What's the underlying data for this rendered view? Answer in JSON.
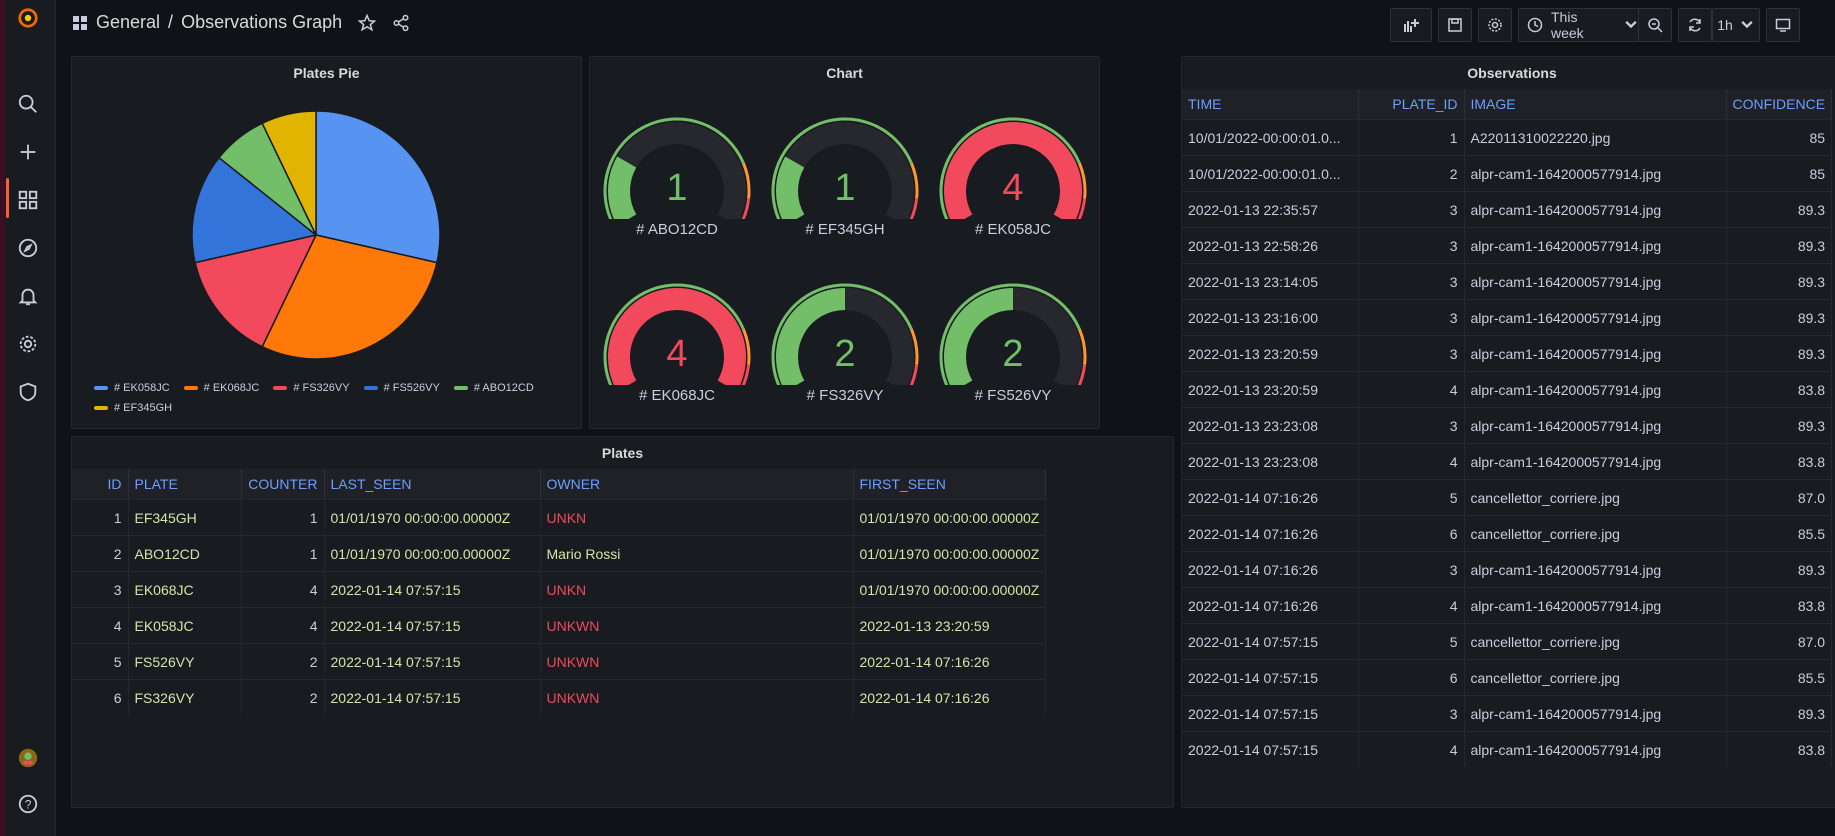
{
  "breadcrumb": {
    "folder": "General",
    "separator": "/",
    "title": "Observations Graph"
  },
  "toolbar": {
    "time_range": "This week",
    "refresh_interval": "1h"
  },
  "colors": {
    "green": "#73bf69",
    "red": "#f2495c",
    "blue": "#5794f2",
    "orange": "#ff780a",
    "yellow": "#f2cc0c"
  },
  "pie_panel": {
    "title": "Plates Pie",
    "chart_data": {
      "type": "pie",
      "slices": [
        {
          "label": "# EK058JC",
          "value": 4,
          "color": "#5794f2"
        },
        {
          "label": "# EK068JC",
          "value": 4,
          "color": "#ff780a"
        },
        {
          "label": "# FS326VY",
          "value": 2,
          "color": "#f2495c"
        },
        {
          "label": "# FS526VY",
          "value": 2,
          "color": "#3274d9"
        },
        {
          "label": "# ABO12CD",
          "value": 1,
          "color": "#73bf69"
        },
        {
          "label": "# EF345GH",
          "value": 1,
          "color": "#e0b400"
        }
      ],
      "legend_placement": "bottom"
    }
  },
  "chart_panel": {
    "title": "Chart",
    "gauges": [
      {
        "label": "# ABO12CD",
        "value": "1",
        "fraction": 0.25,
        "color": "#73bf69"
      },
      {
        "label": "# EF345GH",
        "value": "1",
        "fraction": 0.25,
        "color": "#73bf69"
      },
      {
        "label": "# EK058JC",
        "value": "4",
        "fraction": 1.0,
        "color": "#f2495c"
      },
      {
        "label": "# EK068JC",
        "value": "4",
        "fraction": 1.0,
        "color": "#f2495c"
      },
      {
        "label": "# FS326VY",
        "value": "2",
        "fraction": 0.5,
        "color": "#73bf69"
      },
      {
        "label": "# FS526VY",
        "value": "2",
        "fraction": 0.5,
        "color": "#73bf69"
      }
    ]
  },
  "plates_panel": {
    "title": "Plates",
    "columns": [
      "ID",
      "PLATE",
      "COUNTER",
      "LAST_SEEN",
      "OWNER",
      "FIRST_SEEN"
    ],
    "rows": [
      {
        "id": "1",
        "plate": "EF345GH",
        "counter": "1",
        "last_seen": "01/01/1970 00:00:00.00000Z",
        "owner": "UNKN",
        "first_seen": "01/01/1970 00:00:00.00000Z"
      },
      {
        "id": "2",
        "plate": "ABO12CD",
        "counter": "1",
        "last_seen": "01/01/1970 00:00:00.00000Z",
        "owner": "Mario Rossi",
        "first_seen": "01/01/1970 00:00:00.00000Z"
      },
      {
        "id": "3",
        "plate": "EK068JC",
        "counter": "4",
        "last_seen": "2022-01-14 07:57:15",
        "owner": "UNKN",
        "first_seen": "01/01/1970 00:00:00.00000Z"
      },
      {
        "id": "4",
        "plate": "EK058JC",
        "counter": "4",
        "last_seen": "2022-01-14 07:57:15",
        "owner": "UNKWN",
        "first_seen": "2022-01-13 23:20:59"
      },
      {
        "id": "5",
        "plate": "FS526VY",
        "counter": "2",
        "last_seen": "2022-01-14 07:57:15",
        "owner": "UNKWN",
        "first_seen": "2022-01-14 07:16:26"
      },
      {
        "id": "6",
        "plate": "FS326VY",
        "counter": "2",
        "last_seen": "2022-01-14 07:57:15",
        "owner": "UNKWN",
        "first_seen": "2022-01-14 07:16:26"
      }
    ]
  },
  "observations_panel": {
    "title": "Observations",
    "columns": [
      "TIME",
      "PLATE_ID",
      "IMAGE",
      "CONFIDENCE"
    ],
    "rows": [
      {
        "time": "10/01/2022-00:00:01.0...",
        "plate_id": "1",
        "image": "A22011310022220.jpg",
        "confidence": "85"
      },
      {
        "time": "10/01/2022-00:00:01.0...",
        "plate_id": "2",
        "image": "alpr-cam1-1642000577914.jpg",
        "confidence": "85"
      },
      {
        "time": "2022-01-13 22:35:57",
        "plate_id": "3",
        "image": "alpr-cam1-1642000577914.jpg",
        "confidence": "89.3"
      },
      {
        "time": "2022-01-13 22:58:26",
        "plate_id": "3",
        "image": "alpr-cam1-1642000577914.jpg",
        "confidence": "89.3"
      },
      {
        "time": "2022-01-13 23:14:05",
        "plate_id": "3",
        "image": "alpr-cam1-1642000577914.jpg",
        "confidence": "89.3"
      },
      {
        "time": "2022-01-13 23:16:00",
        "plate_id": "3",
        "image": "alpr-cam1-1642000577914.jpg",
        "confidence": "89.3"
      },
      {
        "time": "2022-01-13 23:20:59",
        "plate_id": "3",
        "image": "alpr-cam1-1642000577914.jpg",
        "confidence": "89.3"
      },
      {
        "time": "2022-01-13 23:20:59",
        "plate_id": "4",
        "image": "alpr-cam1-1642000577914.jpg",
        "confidence": "83.8"
      },
      {
        "time": "2022-01-13 23:23:08",
        "plate_id": "3",
        "image": "alpr-cam1-1642000577914.jpg",
        "confidence": "89.3"
      },
      {
        "time": "2022-01-13 23:23:08",
        "plate_id": "4",
        "image": "alpr-cam1-1642000577914.jpg",
        "confidence": "83.8"
      },
      {
        "time": "2022-01-14 07:16:26",
        "plate_id": "5",
        "image": "cancellettor_corriere.jpg",
        "confidence": "87.0"
      },
      {
        "time": "2022-01-14 07:16:26",
        "plate_id": "6",
        "image": "cancellettor_corriere.jpg",
        "confidence": "85.5"
      },
      {
        "time": "2022-01-14 07:16:26",
        "plate_id": "3",
        "image": "alpr-cam1-1642000577914.jpg",
        "confidence": "89.3"
      },
      {
        "time": "2022-01-14 07:16:26",
        "plate_id": "4",
        "image": "alpr-cam1-1642000577914.jpg",
        "confidence": "83.8"
      },
      {
        "time": "2022-01-14 07:57:15",
        "plate_id": "5",
        "image": "cancellettor_corriere.jpg",
        "confidence": "87.0"
      },
      {
        "time": "2022-01-14 07:57:15",
        "plate_id": "6",
        "image": "cancellettor_corriere.jpg",
        "confidence": "85.5"
      },
      {
        "time": "2022-01-14 07:57:15",
        "plate_id": "3",
        "image": "alpr-cam1-1642000577914.jpg",
        "confidence": "89.3"
      },
      {
        "time": "2022-01-14 07:57:15",
        "plate_id": "4",
        "image": "alpr-cam1-1642000577914.jpg",
        "confidence": "83.8"
      }
    ]
  }
}
